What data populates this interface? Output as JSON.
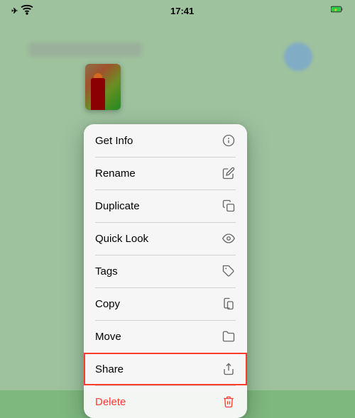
{
  "statusBar": {
    "time": "17:41",
    "icons": {
      "airplane": "✈",
      "wifi": "wifi-icon",
      "battery": "battery-icon"
    }
  },
  "contextMenu": {
    "items": [
      {
        "id": "get-info",
        "label": "Get Info",
        "icon": "info"
      },
      {
        "id": "rename",
        "label": "Rename",
        "icon": "pencil"
      },
      {
        "id": "duplicate",
        "label": "Duplicate",
        "icon": "duplicate"
      },
      {
        "id": "quick-look",
        "label": "Quick Look",
        "icon": "eye"
      },
      {
        "id": "tags",
        "label": "Tags",
        "icon": "tag"
      },
      {
        "id": "copy",
        "label": "Copy",
        "icon": "copy"
      },
      {
        "id": "move",
        "label": "Move",
        "icon": "folder"
      },
      {
        "id": "share",
        "label": "Share",
        "icon": "share",
        "highlighted": true
      },
      {
        "id": "delete",
        "label": "Delete",
        "icon": "trash",
        "destructive": true
      }
    ]
  }
}
